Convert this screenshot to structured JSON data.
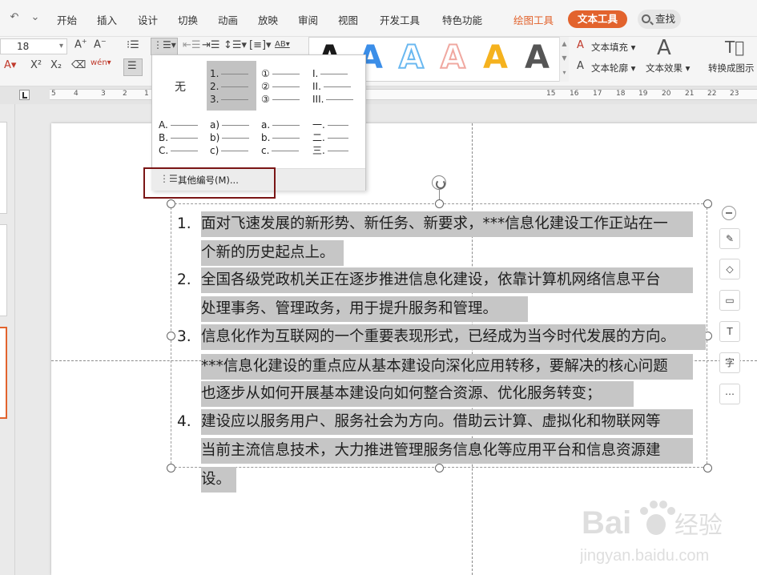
{
  "menu": {
    "items": [
      "开始",
      "插入",
      "设计",
      "切换",
      "动画",
      "放映",
      "审阅",
      "视图",
      "开发工具",
      "特色功能"
    ],
    "drawing_tools": "绘图工具",
    "text_tools": "文本工具",
    "search": "查找"
  },
  "ribbon": {
    "font_size": "18",
    "text_fill": "文本填充",
    "text_outline": "文本轮廓",
    "text_effect": "文本效果",
    "convert": "转换成图示",
    "art_letter": "A",
    "style_colors": [
      "#1a1a1a",
      "#3b8ee8",
      "#6ab8f0",
      "#f0a8a0",
      "#f5b21e",
      "#555555"
    ]
  },
  "ruler": {
    "left_labels": [
      "5",
      "4",
      "3",
      "2",
      "1"
    ],
    "right_labels": [
      "15",
      "16",
      "17",
      "18",
      "19",
      "20",
      "21",
      "22",
      "23"
    ]
  },
  "numbering_dropdown": {
    "none_label": "无",
    "styles": [
      [
        "1.",
        "2.",
        "3."
      ],
      [
        "①",
        "②",
        "③"
      ],
      [
        "I.",
        "II.",
        "III."
      ],
      [
        "A.",
        "B.",
        "C."
      ],
      [
        "a)",
        "b)",
        "c)"
      ],
      [
        "a.",
        "b.",
        "c."
      ],
      [
        "一.",
        "二.",
        "三."
      ]
    ],
    "more_label": "其他编号(M)..."
  },
  "slide": {
    "list": [
      {
        "num": "1.",
        "lines": [
          "面对飞速发展的新形势、新任务、新要求，***信息化建设工作正站在一",
          "个新的历史起点上。"
        ]
      },
      {
        "num": "2.",
        "lines": [
          "全国各级党政机关正在逐步推进信息化建设，依靠计算机网络信息平台",
          "处理事务、管理政务，用于提升服务和管理。"
        ]
      },
      {
        "num": "3.",
        "lines": [
          "信息化作为互联网的一个重要表现形式，已经成为当今时代发展的方向。",
          "***信息化建设的重点应从基本建设向深化应用转移，要解决的核心问题",
          "也逐步从如何开展基本建设向如何整合资源、优化服务转变；"
        ]
      },
      {
        "num": "4.",
        "lines": [
          "建设应以服务用户、服务社会为方向。借助云计算、虚拟化和物联网等",
          "当前主流信息技术，大力推进管理服务信息化等应用平台和信息资源建",
          "设。"
        ]
      }
    ]
  },
  "watermark": {
    "brand_left": "Bai",
    "brand_right": "经验",
    "url": "jingyan.baidu.com"
  },
  "colors": {
    "accent": "#e2632d",
    "highlight_frame": "#7a1515",
    "selection": "#c6c6c6"
  }
}
